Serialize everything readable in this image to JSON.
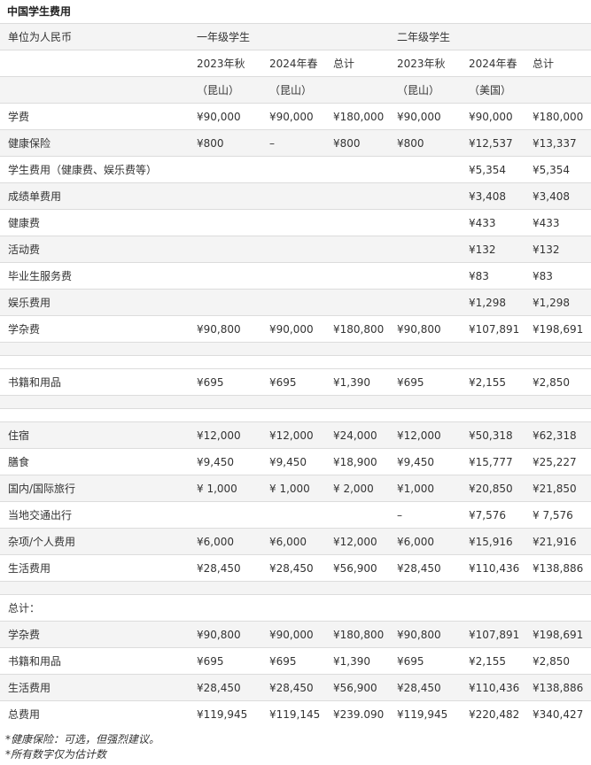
{
  "title": "中国学生费用",
  "header": {
    "unit_label": "单位为人民币",
    "group1": "一年级学生",
    "group2": "二年级学生",
    "terms": [
      "2023年秋",
      "2024年春",
      "总计",
      "2023年秋",
      "2024年春",
      "总计"
    ],
    "locations": [
      "（昆山）",
      "（昆山）",
      "（昆山）",
      "（美国）"
    ]
  },
  "section1": [
    {
      "label": "学费",
      "v": [
        "¥90,000",
        "¥90,000",
        "¥180,000",
        "¥90,000",
        "¥90,000",
        "¥180,000"
      ]
    },
    {
      "label": "健康保险",
      "v": [
        " ¥800",
        "–",
        "¥800",
        "¥800",
        "¥12,537",
        "¥13,337"
      ]
    },
    {
      "label": "学生费用（健康费、娱乐费等）",
      "v": [
        "",
        "",
        "",
        "",
        "¥5,354",
        "¥5,354"
      ]
    },
    {
      "label": "成绩单费用",
      "v": [
        "",
        "",
        "",
        "",
        "¥3,408",
        "¥3,408"
      ]
    },
    {
      "label": "健康费",
      "v": [
        "",
        "",
        "",
        "",
        "¥433",
        "¥433"
      ]
    },
    {
      "label": "活动费",
      "v": [
        "",
        "",
        "",
        "",
        "¥132",
        "¥132"
      ]
    },
    {
      "label": "毕业生服务费",
      "v": [
        "",
        "",
        "",
        "",
        "¥83",
        "¥83"
      ]
    },
    {
      "label": "娱乐费用",
      "v": [
        "",
        "",
        "",
        "",
        "¥1,298",
        "¥1,298"
      ]
    },
    {
      "label": "学杂费",
      "v": [
        "¥90,800",
        "¥90,000",
        "¥180,800",
        "¥90,800",
        "¥107,891",
        "¥198,691"
      ]
    }
  ],
  "section2": [
    {
      "label": "书籍和用品",
      "v": [
        "¥695",
        "¥695",
        "¥1,390",
        "¥695",
        "¥2,155",
        "¥2,850"
      ]
    }
  ],
  "section3": [
    {
      "label": "住宿",
      "v": [
        "¥12,000",
        "¥12,000",
        "¥24,000",
        "¥12,000",
        "¥50,318",
        "¥62,318"
      ]
    },
    {
      "label": "膳食",
      "v": [
        "¥9,450",
        "¥9,450",
        "¥18,900",
        "¥9,450",
        "¥15,777",
        "¥25,227"
      ]
    },
    {
      "label": "国内/国际旅行",
      "v": [
        "¥ 1,000",
        "¥ 1,000",
        "¥ 2,000",
        "¥1,000",
        "¥20,850",
        "¥21,850"
      ]
    },
    {
      "label": "当地交通出行",
      "v": [
        "",
        "",
        "",
        "–",
        "¥7,576",
        "¥ 7,576"
      ]
    },
    {
      "label": "杂项/个人费用",
      "v": [
        "¥6,000",
        "¥6,000",
        "¥12,000",
        "¥6,000",
        "¥15,916",
        "¥21,916"
      ]
    },
    {
      "label": "生活费用",
      "v": [
        "¥28,450",
        "¥28,450",
        "¥56,900",
        "¥28,450",
        "¥110,436",
        "¥138,886"
      ]
    }
  ],
  "totals_label": "总计：",
  "totals": [
    {
      "label": "学杂费",
      "v": [
        "¥90,800",
        "¥90,000",
        "¥180,800",
        "¥90,800",
        "¥107,891",
        "¥198,691"
      ]
    },
    {
      "label": "书籍和用品",
      "v": [
        "¥695",
        "¥695",
        "¥1,390",
        "¥695",
        "¥2,155",
        "¥2,850"
      ]
    },
    {
      "label": "生活费用",
      "v": [
        "¥28,450",
        "¥28,450",
        "¥56,900",
        "¥28,450",
        "¥110,436",
        "¥138,886"
      ]
    },
    {
      "label": "总费用",
      "v": [
        "¥119,945",
        "¥119,145",
        "¥239.090",
        "¥119,945",
        "¥220,482",
        "¥340,427"
      ]
    }
  ],
  "notes": [
    "*健康保险：可选，但强烈建议。",
    "*所有数字仅为估计数"
  ]
}
